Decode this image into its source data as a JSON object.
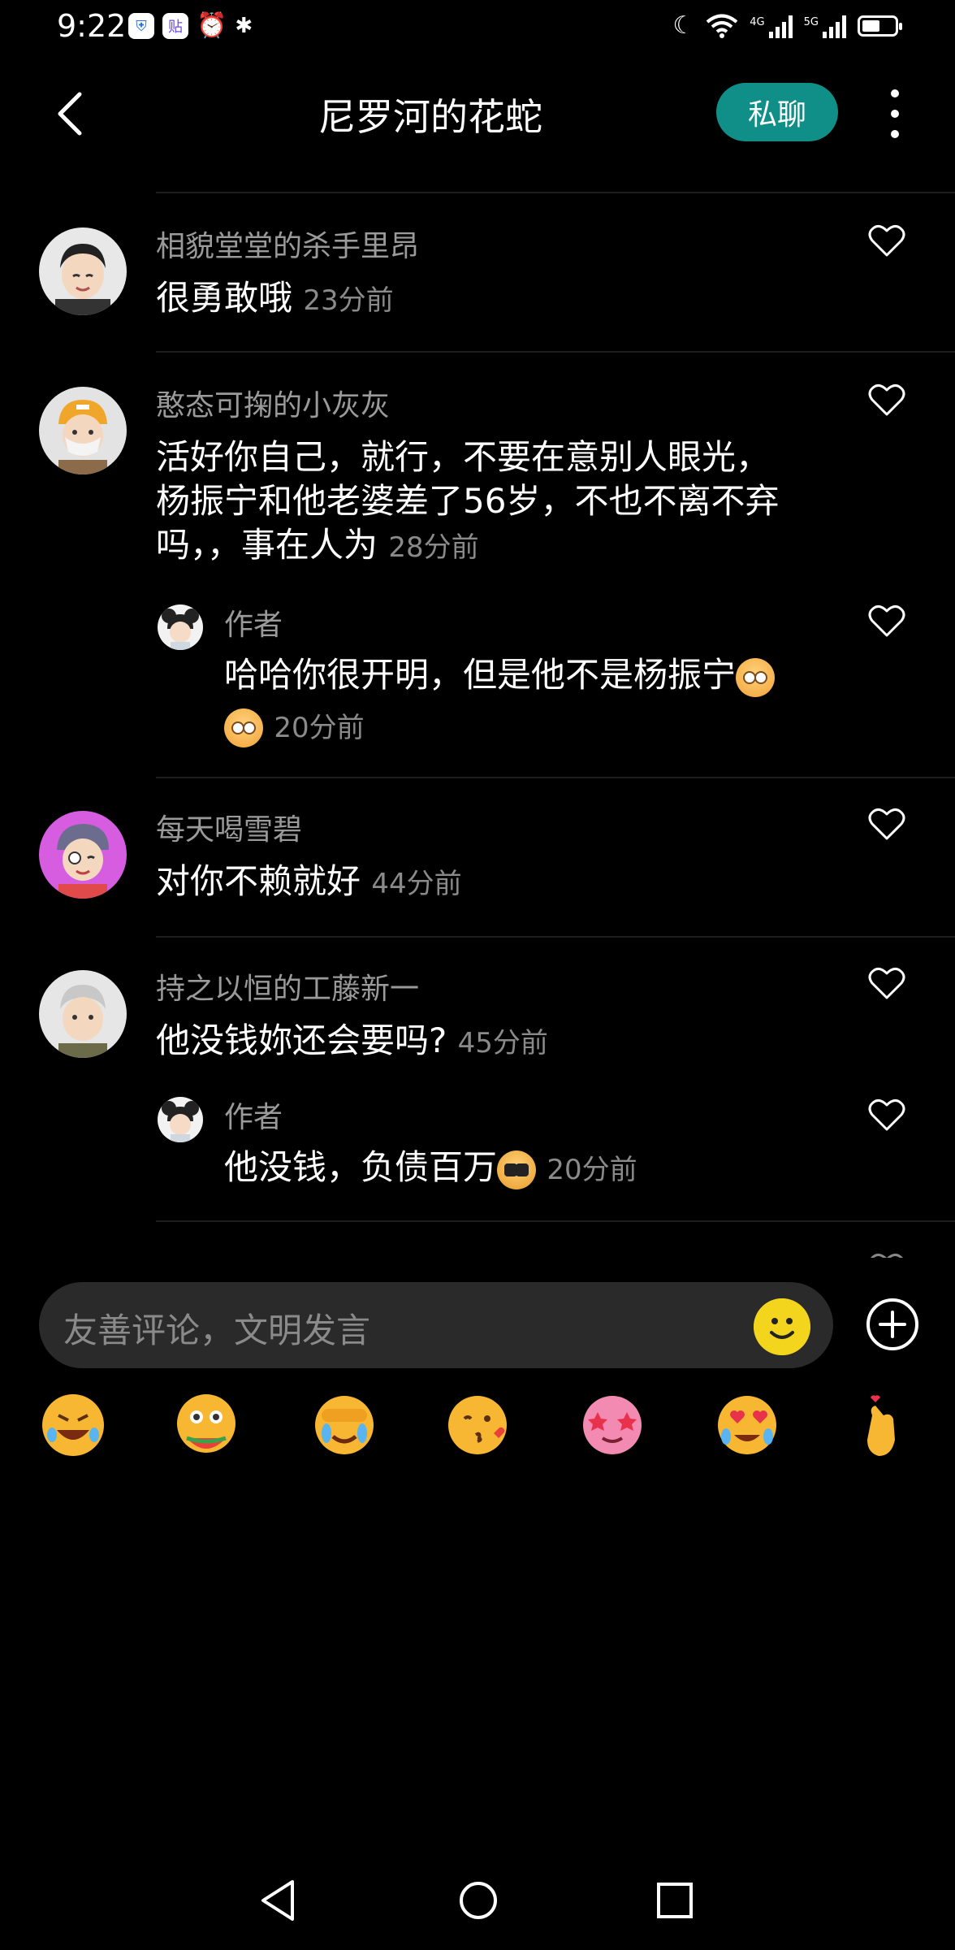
{
  "status_bar": {
    "time": "9:22",
    "network_1": "4G",
    "network_2": "5G",
    "battery_level": 0.55
  },
  "header": {
    "title": "尼罗河的花蛇",
    "dm_label": "私聊"
  },
  "comments": [
    {
      "author": "相貌堂堂的杀手里昂",
      "text": "很勇敢哦",
      "time": "23分前"
    },
    {
      "author": "憨态可掬的小灰灰",
      "text_lines": [
        "活好你自己，就行，不要在意别人眼光，",
        "杨振宁和他老婆差了56岁，不也不离不弃",
        "吗，，事在人为"
      ],
      "time": "28分前",
      "reply": {
        "author": "作者",
        "text_line1": "哈哈你很开明，但是他不是杨振宁",
        "time": "20分前"
      }
    },
    {
      "author": "每天喝雪碧",
      "text": "对你不赖就好",
      "time": "44分前"
    },
    {
      "author": "持之以恒的工藤新一",
      "text": "他没钱妳还会要吗?",
      "time": "45分前",
      "reply": {
        "author": "作者",
        "text": "他没钱，负债百万",
        "time": "20分前"
      }
    }
  ],
  "input": {
    "placeholder": "友善评论，文明发言"
  },
  "emoji_bar": [
    "rofl-emoji",
    "watermelon-eating-emoji",
    "crying-facepalm-emoji",
    "kiss-heart-emoji",
    "star-struck-emoji",
    "heart-eyes-crying-emoji",
    "finger-heart-emoji"
  ],
  "icons": {
    "back": "chevron-left-icon",
    "more": "more-vertical-icon",
    "like": "heart-outline-icon",
    "add": "plus-circle-icon",
    "nav_back": "triangle-back-icon",
    "nav_home": "circle-home-icon",
    "nav_recent": "square-recent-icon"
  }
}
